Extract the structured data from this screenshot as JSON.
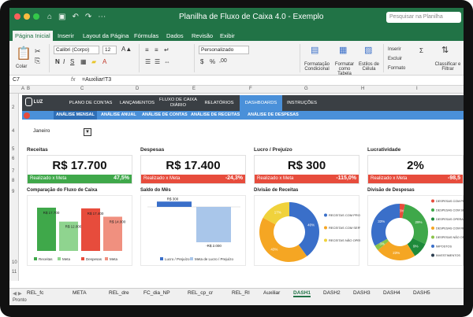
{
  "window": {
    "title": "Planilha de Fluxo de Caixa 4.0 - Exemplo"
  },
  "search": {
    "placeholder": "Pesquisar na Planilha"
  },
  "ribbon_tabs": [
    "Página Inicial",
    "Inserir",
    "Layout da Página",
    "Fórmulas",
    "Dados",
    "Revisão",
    "Exibir"
  ],
  "ribbon": {
    "paste_label": "Colar",
    "font_name": "Calibri (Corpo)",
    "font_size": "12",
    "number_format": "Personalizado",
    "cond_format_label": "Formatação Condicional",
    "format_table_label": "Formatar como Tabela",
    "cell_styles_label": "Estilos de Célula",
    "insert_label": "Inserir",
    "delete_label": "Excluir",
    "format_label": "Formato",
    "sort_filter_label": "Classificar e Filtrar"
  },
  "formula_bar": {
    "cell_ref": "C7",
    "fx": "fx",
    "formula": "=Auxiliar!T3"
  },
  "columns": [
    "A",
    "B",
    "C",
    "D",
    "E",
    "F",
    "G",
    "H",
    "I"
  ],
  "rows": [
    "2",
    "4",
    "5",
    "6",
    "7",
    "8",
    "9",
    "10",
    "11"
  ],
  "dash_nav": {
    "logo": "LUZ",
    "items": [
      "PLANO DE CONTAS",
      "LANÇAMENTOS",
      "FLUXO DE CAIXA DIÁRIO",
      "RELATÓRIOS",
      "DASHBOARDS",
      "INSTRUÇÕES"
    ],
    "sub_items": [
      "ANÁLISE MENSAL",
      "ANÁLISE ANUAL",
      "ANÁLISE DE CONTAS",
      "ANÁLISE DE RECEITAS",
      "ANÁLISE DE DESPESAS"
    ]
  },
  "month": "Janeiro",
  "kpis": [
    {
      "title": "Receitas",
      "value": "R$ 17.700",
      "bar_label": "Realizado x Meta",
      "bar_value": "47,5%",
      "status": "green"
    },
    {
      "title": "Despesas",
      "value": "R$ 17.400",
      "bar_label": "Realizado x Meta",
      "bar_value": "-24,3%",
      "status": "red"
    },
    {
      "title": "Lucro / Prejuízo",
      "value": "R$ 300",
      "bar_label": "Realizado x Meta",
      "bar_value": "-115,0%",
      "status": "red"
    },
    {
      "title": "Lucratividade",
      "value": "2%",
      "bar_label": "Realizado x Meta",
      "bar_value": "-98,5",
      "status": "red"
    }
  ],
  "panels": {
    "comparacao": "Comparação do Fluxo de Caixa",
    "saldo": "Saldo do Mês",
    "div_receitas": "Divisão de Receitas",
    "div_despesas": "Divisão de Despesas"
  },
  "chart_data": [
    {
      "type": "bar",
      "title": "Comparação do Fluxo de Caixa",
      "categories": [
        "Receitas",
        "Meta",
        "Despesas",
        "Meta"
      ],
      "values": [
        17700,
        12000,
        17400,
        14000
      ],
      "labels": [
        "R$ 17.700",
        "R$ 12.000",
        "R$ 17.400",
        "R$ 14.000"
      ],
      "colors": [
        "#3fa84a",
        "#8fd48f",
        "#e74c3c",
        "#f0907f"
      ],
      "legend": [
        "Receitas",
        "Meta",
        "Despesas",
        "Meta"
      ]
    },
    {
      "type": "bar",
      "title": "Saldo do Mês",
      "categories": [
        "Lucro / Prejuízo",
        "Meta de Lucro / Prejuízo"
      ],
      "values": [
        300,
        -2000
      ],
      "labels": [
        "R$ 300",
        "-R$ 2.000"
      ],
      "colors": [
        "#3a6fc9",
        "#a9c6ea"
      ],
      "legend": [
        "Lucro / Prejuízo",
        "Meta de Lucro / Prejuízo"
      ]
    },
    {
      "type": "pie",
      "title": "Divisão de Receitas",
      "categories": [
        "RECEITAS COM PRODUTOS",
        "RECEITAS COM SERVIÇOS",
        "RECEITAS NÃO OPERACIONAIS"
      ],
      "values": [
        40,
        43,
        17
      ],
      "labels": [
        "40%",
        "43%",
        "17%"
      ],
      "colors": [
        "#3a6fc9",
        "#f5a623",
        "#f0d23c"
      ]
    },
    {
      "type": "pie",
      "title": "Divisão de Despesas",
      "categories": [
        "DESPESAS COM PRODUTOS",
        "DESPESAS COM SERVIÇOS",
        "DESPESAS OPERACIONAIS",
        "DESPESAS COM RH",
        "DESPESAS NÃO OPERACIONAIS",
        "IMPOSTOS",
        "INVESTIMENTOS"
      ],
      "values": [
        3,
        29,
        9,
        23,
        3,
        33,
        0
      ],
      "labels": [
        "3%",
        "29%",
        "9%",
        "23%",
        "3%",
        "33%",
        "0%"
      ],
      "colors": [
        "#e74c3c",
        "#3fa84a",
        "#1e8a3a",
        "#f5a623",
        "#8bc34a",
        "#3a6fc9",
        "#2c3e50"
      ]
    }
  ],
  "sheet_tabs": [
    "REL_fc",
    "META",
    "REL_dre",
    "FC_dia_NP",
    "REL_cp_cr",
    "REL_RI",
    "Auxiliar",
    "DASH1",
    "DASH2",
    "DASH3",
    "DASH4",
    "DASH5"
  ],
  "status": {
    "left": "Pronto"
  }
}
